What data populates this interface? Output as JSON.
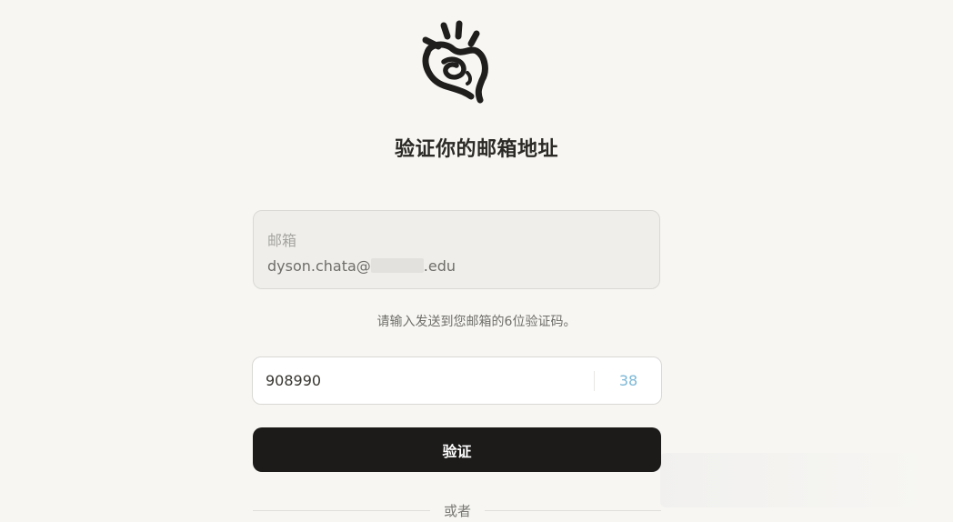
{
  "logo": {
    "icon": "hand-ok-gesture-icon"
  },
  "page": {
    "title": "验证你的邮箱地址"
  },
  "email": {
    "label": "邮箱",
    "value_prefix": "dyson.chata@",
    "value_suffix": ".edu"
  },
  "helper": {
    "text": "请输入发送到您邮箱的6位验证码。"
  },
  "code": {
    "value": "908990",
    "countdown": "38"
  },
  "buttons": {
    "verify_label": "验证"
  },
  "divider": {
    "text": "或者"
  },
  "colors": {
    "background": "#f7f6f3",
    "primary_button": "#1c1b19",
    "countdown_accent": "#7cb7d6"
  }
}
